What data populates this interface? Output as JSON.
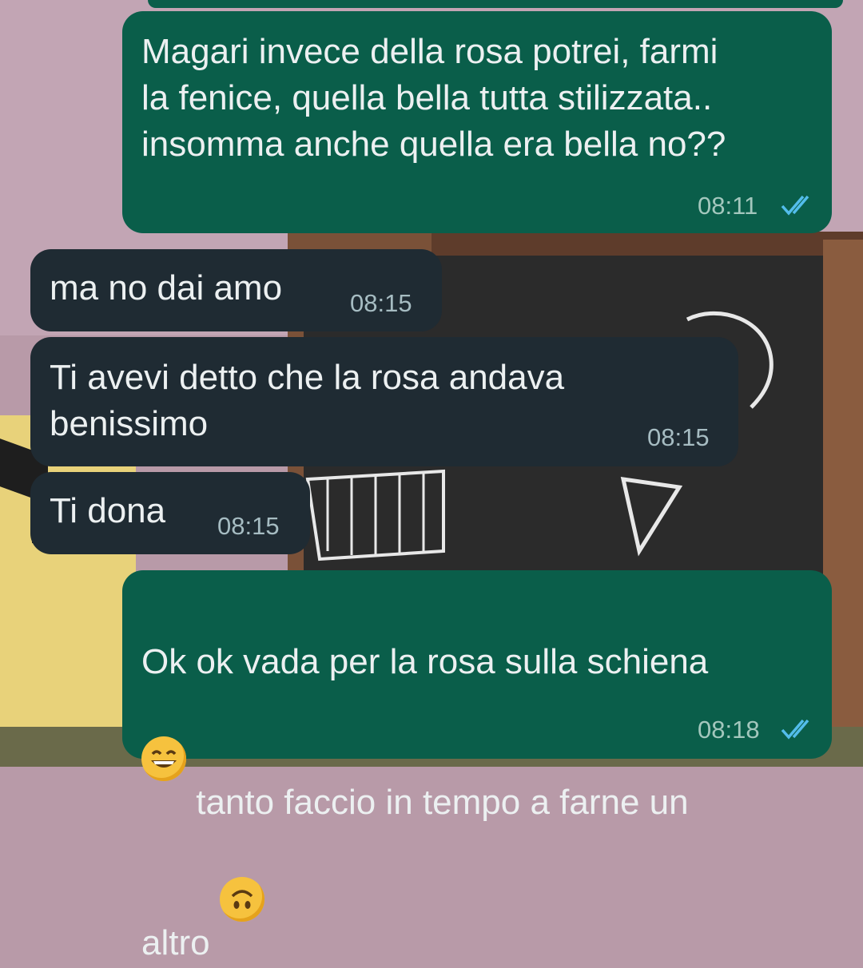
{
  "chat": {
    "messages": [
      {
        "direction": "outgoing",
        "text": "Magari invece della rosa potrei, farmi\nla fenice, quella bella tutta stilizzata..\ninsomma anche quella era bella no??",
        "time": "08:11",
        "status": "read"
      },
      {
        "direction": "incoming",
        "text": "ma no dai amo",
        "time": "08:15"
      },
      {
        "direction": "incoming",
        "text": "Ti avevi detto che la rosa andava\nbenissimo",
        "time": "08:15"
      },
      {
        "direction": "incoming",
        "text": "Ti dona",
        "time": "08:15"
      },
      {
        "direction": "outgoing",
        "line1": "Ok ok vada per la rosa sulla schiena",
        "line2": " tanto faccio in tempo a farne un",
        "line3": "altro ",
        "emoji1": "grinning-face-emoji",
        "emoji2": "upside-down-face-emoji",
        "time": "08:18",
        "status": "read"
      }
    ]
  },
  "colors": {
    "outgoing_bubble": "#0a5e4a",
    "incoming_bubble": "#1f2b33",
    "read_ticks": "#53bdeb",
    "timestamp": "#a6bcc2"
  },
  "icons": {
    "read_receipt": "double-check-icon"
  }
}
